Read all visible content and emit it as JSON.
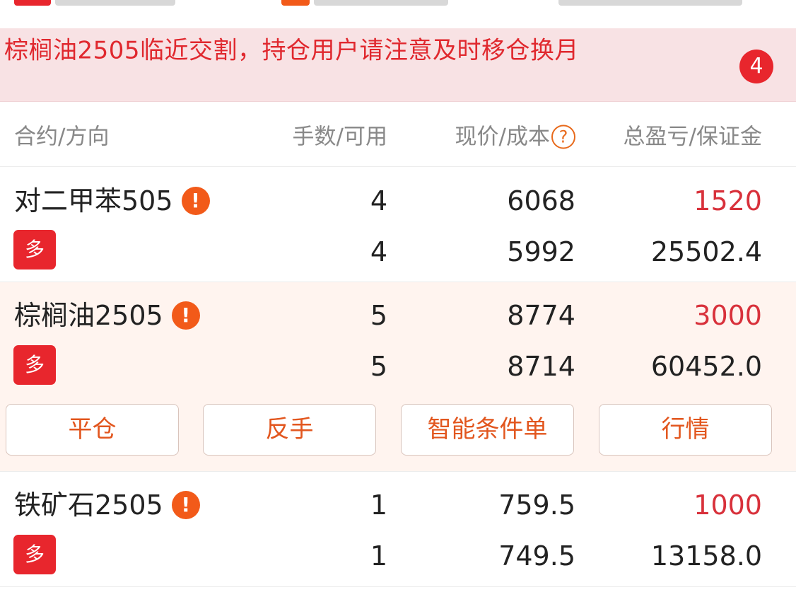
{
  "notice": {
    "text": "棕榈油2505临近交割，持仓用户请注意及时移仓换月",
    "count": "4"
  },
  "columns": {
    "contract": "合约/方向",
    "lots": "手数/可用",
    "price": "现价/成本",
    "pnl": "总盈亏/保证金",
    "help_glyph": "?"
  },
  "positions": [
    {
      "name": "对二甲苯505",
      "direction": "多",
      "lots": "4",
      "available": "4",
      "price": "6068",
      "cost": "5992",
      "pnl": "1520",
      "margin": "25502.4"
    },
    {
      "name": "棕榈油2505",
      "direction": "多",
      "lots": "5",
      "available": "5",
      "price": "8774",
      "cost": "8714",
      "pnl": "3000",
      "margin": "60452.0"
    },
    {
      "name": "铁矿石2505",
      "direction": "多",
      "lots": "1",
      "available": "1",
      "price": "759.5",
      "cost": "749.5",
      "pnl": "1000",
      "margin": "13158.0"
    }
  ],
  "actions": {
    "close": "平仓",
    "reverse": "反手",
    "smart_order": "智能条件单",
    "quote": "行情"
  },
  "icons": {
    "warning": "!"
  },
  "colors": {
    "accent_red": "#e8262d",
    "profit_red": "#d8313b",
    "action_orange": "#e2561e",
    "selected_bg": "#fff4ef",
    "notice_bg": "#f8e2e4"
  }
}
